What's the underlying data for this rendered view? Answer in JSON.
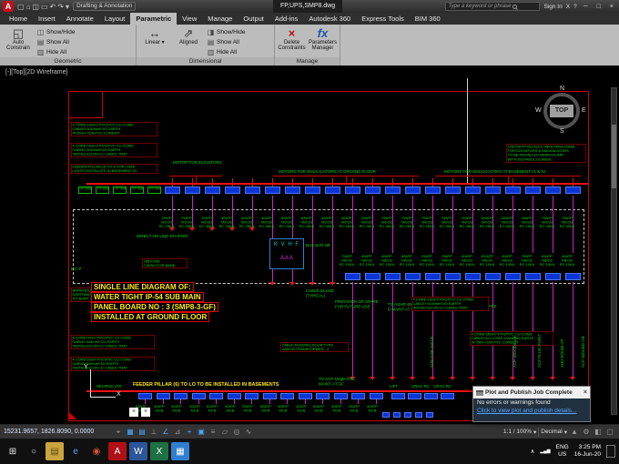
{
  "titlebar": {
    "logo": "A",
    "qat": [
      {
        "name": "new-file-icon",
        "glyph": "▢"
      },
      {
        "name": "open-file-icon",
        "glyph": "⌂"
      },
      {
        "name": "save-icon",
        "glyph": "◫"
      },
      {
        "name": "plot-icon",
        "glyph": "▭"
      },
      {
        "name": "undo-icon",
        "glyph": "↶"
      },
      {
        "name": "redo-icon",
        "glyph": "↷"
      },
      {
        "name": "workspace-caret-icon",
        "glyph": "▾"
      }
    ],
    "workspace": "Drafting & Annotation",
    "filename": "FP,UPS,SMP8.dwg",
    "search_placeholder": "Type a keyword or phrase",
    "signin": "Sign In",
    "exchange": "X",
    "help": "?",
    "window": {
      "minimize": "─",
      "maximize": "□",
      "close": "×"
    }
  },
  "ribbon": {
    "tabs": [
      {
        "label": "Home",
        "active": false
      },
      {
        "label": "Insert",
        "active": false
      },
      {
        "label": "Annotate",
        "active": false
      },
      {
        "label": "Layout",
        "active": false
      },
      {
        "label": "Parametric",
        "active": true
      },
      {
        "label": "View",
        "active": false
      },
      {
        "label": "Manage",
        "active": false
      },
      {
        "label": "Output",
        "active": false
      },
      {
        "label": "Add-ins",
        "active": false
      },
      {
        "label": "Autodesk 360",
        "active": false
      },
      {
        "label": "Express Tools",
        "active": false
      },
      {
        "label": "BIM 360",
        "active": false
      }
    ],
    "icons": {
      "auto_constrain": "◱",
      "show_hide": "◫",
      "show_all": "▤",
      "hide_all": "▥",
      "linear": "↔",
      "aligned": "⇗",
      "dim_show_hide": "◨",
      "dim_show_all": "▤",
      "dim_hide_all": "▥",
      "delete_constraints": "×",
      "parameters_manager": "fx",
      "caret": "▾"
    },
    "geometric": {
      "title": "Geometric",
      "auto_constrain": "Auto Constrain",
      "show_hide": "Show/Hide",
      "show_all": "Show All",
      "hide_all": "Hide All"
    },
    "dimensional": {
      "title": "Dimensional",
      "linear": "Linear",
      "aligned": "Aligned",
      "show_hide": "Show/Hide",
      "show_all": "Show All",
      "hide_all": "Hide All"
    },
    "manage": {
      "title": "Manage",
      "delete_constraints": "Delete Constraints",
      "parameters_manager": "Parameters Manager"
    }
  },
  "canvas": {
    "viewport_label": "[-][Top][2D Wireframe]",
    "compass": {
      "n": "N",
      "w": "W",
      "e": "E",
      "s": "S",
      "top": "TOP"
    },
    "group_labels": {
      "elevators": "MOTOR FOR ELEVATORS",
      "ground_floor": "MOTORS FOR WALKALATORS AT GROUND FLOOR",
      "basement": "MOTORS FOR WALKALATORS AT BASEMENT 01 & 02"
    },
    "note_tl1": [
      "4 CORE 10mm² PVC/PVC CU COND",
      "CABLE+1x10mm² AS EARTH",
      "IN 50mm DIA PVC CONDUIT"
    ],
    "note_tl2": [
      "4 CORE 16mm² PVC/PVC CU COND",
      "CABLE+1x16mm² AS EARTH",
      "INSTALLED ON G.I CABLE TRAY"
    ],
    "note_tl3": [
      "FEEDER PILLAR (3) TO & FOR LOAD",
      "LIGHTS INSTALLED IN BASEMENT 03"
    ],
    "note_tr": [
      "125/75ATP MCCB EC 35KA 45KA DOMB",
      "FOR ELEVATORS & WALKALATORS",
      "TO BE INSTALLED NEAR MC/MR",
      "WITH SUITABLE GLANDS"
    ],
    "note_mr": [
      "4 CORE 16mm² PVC/PVC CU COND.",
      "CABLE+1x16mm² AS EARTH",
      "INSTALLED ON G.I CABLE TRAY"
    ],
    "note_br": [
      "4 CORE 35mm² PVC/PVC CU COND.",
      "CABLE+2x1 CORE 16mm² AS EARTH",
      "IN 75mm DIA PVC CONDUIT"
    ],
    "note_bl1": [
      "8 CORE 4mm² PVC/PVC CU COND",
      "CABLE+4x4mm² CU EARTH",
      "INSTALLED ON G.I CABLE TRAY"
    ],
    "note_bl2": [
      "4 CORE 6mm² PVC/PVC CU COND",
      "CABLE+1x6mm² AS EARTH",
      "INSTALLED ON G.I CABLE TRAY"
    ],
    "dol_label": "DIRECT ON LINE STARTER",
    "kvhf": {
      "letters": "K V H F",
      "ammeters": "A   A   A"
    },
    "busbar_label": "BUS BAR 3Ø",
    "capacitor": [
      "185 KVAR",
      "CAPACITOR BANK"
    ],
    "ecp_label": "E.C.P",
    "borehole": [
      "BOREHOLE",
      "EARTHING",
      "PIT BSMT 03"
    ],
    "cable_gland": [
      "CABLE GLAND",
      "(TYPICAL)"
    ],
    "provision": [
      "PROVISION OF SPARE",
      "FOR FUTURE USE"
    ],
    "aghp": [
      "TO AGHP 400x300",
      "E-MAINT AT GF"
    ],
    "spare_label": "SPARE",
    "transformer": [
      "CABLE FEEDING DOOR TYPE",
      "400KVA TRANSFORMER - 2"
    ],
    "feeder_pillar": "FEEDER PILLAR (6) TO LO TO BE INSTALLED IN BASEMENTS",
    "to_acp": [
      "TO ACP 4SQB-T/RC",
      "MAINT. AT GF"
    ],
    "helipad_label": "HELIPAD LTG",
    "cmd_close": "×",
    "ucs": {
      "x": "X",
      "y": "Y"
    },
    "title_block": [
      "SINGLE LINE DIAGRAM OF:",
      "WATER TIGHT IP-54 SUB MAIN",
      "PANEL BOARD NO : 3 (SMP8-3-GF)",
      "INSTALLED AT GROUND FLOOR"
    ],
    "row1_left": [
      "FP-65A",
      "FP-65A",
      "FP-40A",
      "FP-40A",
      "FP-40A"
    ],
    "row1_feeders": [
      [
        "75ATP",
        "MCCB",
        "RC 25KA"
      ],
      [
        "75ATP",
        "MCCB",
        "RC 25KA"
      ],
      [
        "75ATP",
        "MCCB",
        "EC 35KA"
      ],
      [
        "40ATP",
        "MCCB",
        "RC 25KA"
      ],
      [
        "40ATP",
        "MCCB",
        "RC 25KA"
      ],
      [
        "40ATP",
        "MCCB",
        "EC 35KA"
      ],
      [
        "63ATP",
        "MCCB",
        "RC 25KA"
      ],
      [
        "63ATP",
        "MCCB",
        "RC 25KA"
      ],
      [
        "40ATP",
        "MCCB",
        "EC 35KA"
      ],
      [
        "40ATP",
        "MCCB",
        "RC 25KA"
      ],
      [
        "25ATP",
        "MCCB",
        "RC 25KA"
      ],
      [
        "75ATP",
        "MCCB",
        "EC 35KA"
      ],
      [
        "75ATP",
        "MCCB",
        "RC 25KA"
      ],
      [
        "75ATP",
        "MCCB",
        "RC 25KA"
      ],
      [
        "75ATP",
        "MCCB",
        "EC 35KA"
      ],
      [
        "20ATP",
        "MCCB",
        "RC 25KA"
      ],
      [
        "100ATP",
        "MCCB",
        "RC 25KA"
      ],
      [
        "125ATP",
        "MCCB",
        "EC 35KA"
      ],
      [
        "40ATP",
        "MCCB",
        "RC 25KA"
      ],
      [
        "75ATP",
        "MCCB",
        "RC 25KA"
      ],
      [
        "75ATP",
        "MCCB",
        "EC 35KA"
      ]
    ],
    "row1b_feeders": [
      [
        "75ATP",
        "MECB",
        "RC 10KA"
      ],
      [
        "40ATP",
        "MECB",
        "RC 10KA"
      ],
      [
        "40ATP",
        "MECB",
        "RC 10KA"
      ],
      [
        "63ATP",
        "MECB",
        "RC 10KA"
      ],
      [
        "25ATP",
        "MECB",
        "RC 10KA"
      ],
      [
        "75ATP",
        "MECB",
        "RC 10KA"
      ],
      [
        "40ATP",
        "MECB",
        "RC 10KA"
      ],
      [
        "100ATP",
        "MECB",
        "RC 10KA"
      ],
      [
        "40ATP",
        "MECB",
        "RC 10KA"
      ],
      [
        "75ATP",
        "MECB",
        "RC 10KA"
      ],
      [
        "63ATP",
        "MECB",
        "RC 10KA"
      ],
      [
        "40ATP",
        "MECB",
        "RC 10KA"
      ]
    ],
    "row2_feeders": [
      [
        "63ATP",
        "MCB"
      ],
      [
        "40ATP",
        "MCB"
      ],
      [
        "40ATP",
        "MCB"
      ],
      [
        "32ATP",
        "MCB"
      ],
      [
        "63ATP",
        "MCB"
      ],
      [
        "40ATP",
        "MCB"
      ],
      [
        "25ATP",
        "MCB"
      ],
      [
        "63ATP",
        "MCB"
      ],
      [
        "40ATP",
        "MCB"
      ],
      [
        "32ATP",
        "MCB"
      ],
      [
        "63ATP",
        "MCB"
      ],
      [
        "40ATP",
        "MCB"
      ],
      [
        "25ATP",
        "MCB"
      ],
      [
        "40ATP",
        "MCB"
      ]
    ],
    "lift_labels": [
      "LIFT",
      "CRAC RC",
      "CRAC RC"
    ],
    "vertical_labels": [
      "SUB FOR AHU R",
      "ACP 400x300 GB",
      "ACP PLUG POINT",
      "AHU ROOM GF",
      "ACP 400x300 GB"
    ]
  },
  "statusbar": {
    "coords": "15231.9657, 1826.8090, 0.0000",
    "icons": [
      {
        "name": "infer-constraints-icon",
        "glyph": "⌖",
        "active": false
      },
      {
        "name": "snap-mode-icon",
        "glyph": "▦",
        "active": true
      },
      {
        "name": "grid-display-icon",
        "glyph": "▤",
        "active": true
      },
      {
        "name": "ortho-mode-icon",
        "glyph": "⊥",
        "active": false
      },
      {
        "name": "polar-tracking-icon",
        "glyph": "∠",
        "active": true
      },
      {
        "name": "isometric-drafting-icon",
        "glyph": "⊿",
        "active": false
      },
      {
        "name": "object-snap-tracking-icon",
        "glyph": "+",
        "active": true
      },
      {
        "name": "object-snap-icon",
        "glyph": "▣",
        "active": true
      },
      {
        "name": "lineweight-icon",
        "glyph": "≡",
        "active": false
      },
      {
        "name": "transparency-icon",
        "glyph": "▱",
        "active": false
      },
      {
        "name": "selection-cycling-icon",
        "glyph": "◎",
        "active": false
      },
      {
        "name": "dynamic-input-icon",
        "glyph": "∿",
        "active": false
      }
    ],
    "scale": "1:1 / 100%",
    "caret": "▾",
    "units": "Decimal",
    "right_icons": [
      {
        "name": "annotation-visibility-icon",
        "glyph": "▲"
      },
      {
        "name": "workspace-switching-icon",
        "glyph": "⚙"
      },
      {
        "name": "isolate-objects-icon",
        "glyph": "◧"
      },
      {
        "name": "clean-screen-icon",
        "glyph": "▢"
      }
    ]
  },
  "notification": {
    "title": "Plot and Publish Job Complete",
    "body": "No errors or warnings found",
    "link": "Click to view plot and publish details...",
    "close": "×"
  },
  "taskbar": {
    "icons": [
      {
        "name": "start-button",
        "glyph": "⊞",
        "bg": "",
        "fg": "#e8e8e8"
      },
      {
        "name": "search-icon",
        "glyph": "○",
        "bg": "",
        "fg": "#cfcfcf"
      },
      {
        "name": "file-explorer-icon",
        "glyph": "▤",
        "bg": "#caa53d",
        "fg": "#5a4a14"
      },
      {
        "name": "internet-explorer-icon",
        "glyph": "e",
        "bg": "",
        "fg": "#4aa3ff"
      },
      {
        "name": "chrome-icon",
        "glyph": "◉",
        "bg": "",
        "fg": "#d94f3d"
      },
      {
        "name": "autocad-icon",
        "glyph": "A",
        "bg": "#b01116",
        "fg": "#ffffff"
      },
      {
        "name": "word-icon",
        "glyph": "W",
        "bg": "#2b579a",
        "fg": "#ffffff"
      },
      {
        "name": "excel-icon",
        "glyph": "X",
        "bg": "#1e7145",
        "fg": "#ffffff"
      },
      {
        "name": "photos-icon",
        "glyph": "▦",
        "bg": "#2f7fd0",
        "fg": "#ffffff"
      }
    ],
    "tray": {
      "chevron": "∧",
      "network": "▂▄▆",
      "lang1": "ENG",
      "lang2": "US",
      "time": "3:25 PM",
      "date": "16-Jun-20"
    }
  }
}
